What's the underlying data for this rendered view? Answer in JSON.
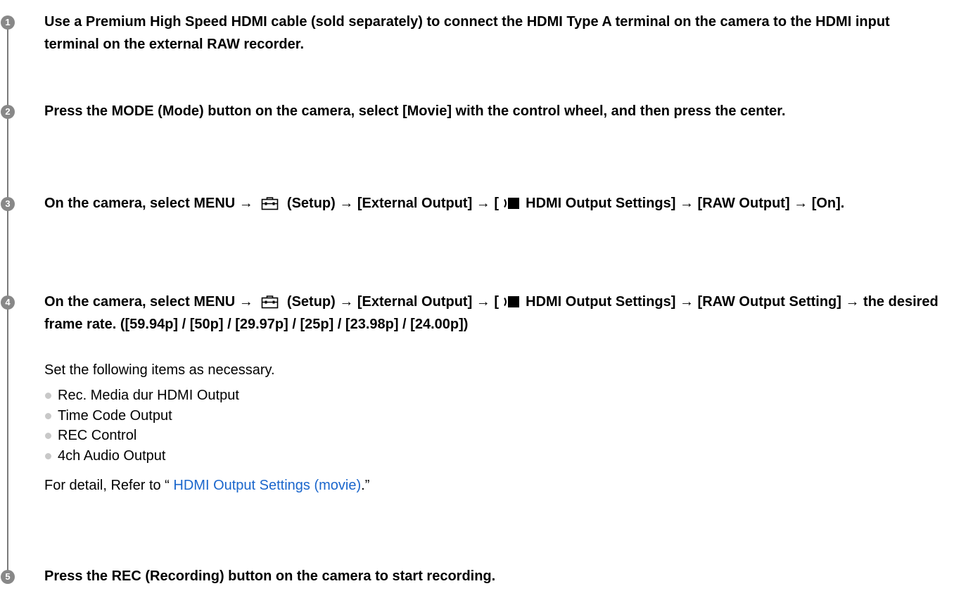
{
  "steps": [
    {
      "number": "1",
      "text": "Use a Premium High Speed HDMI cable (sold separately) to connect the HDMI Type A terminal on the camera to the HDMI input terminal on the external RAW recorder."
    },
    {
      "number": "2",
      "text": "Press the MODE (Mode) button on the camera, select [Movie] with the control wheel, and then press the center."
    },
    {
      "number": "3",
      "text_before_setup": "On the camera, select MENU →",
      "text_after_setup": "(Setup) → [External Output] → [",
      "text_after_movie": "HDMI Output Settings] → [RAW Output] → [On]."
    },
    {
      "number": "4",
      "text_before_setup": "On the camera, select MENU →",
      "text_after_setup": "(Setup) → [External Output] → [",
      "text_after_movie": "HDMI Output Settings] → [RAW Output Setting] → the desired frame rate. ([59.94p] / [50p] / [29.97p] / [25p] / [23.98p] / [24.00p])",
      "note": "Set the following items as necessary.",
      "items": [
        "Rec. Media dur HDMI Output",
        "Time Code Output",
        "REC Control",
        "4ch Audio Output"
      ],
      "detail_prefix": "For detail, Refer to “ ",
      "detail_link": "HDMI Output Settings (movie)",
      "detail_suffix": ".”"
    },
    {
      "number": "5",
      "text": "Press the REC (Recording) button on the camera to start recording."
    }
  ],
  "icons": {
    "setup": "toolbox-setup-icon",
    "movie": "movie-mode-icon",
    "bullet": "bullet-dot-icon"
  },
  "colors": {
    "step_circle": "#888888",
    "step_line": "#7a7a7a",
    "link": "#1a66cc",
    "bullet": "#c8c8c8"
  }
}
